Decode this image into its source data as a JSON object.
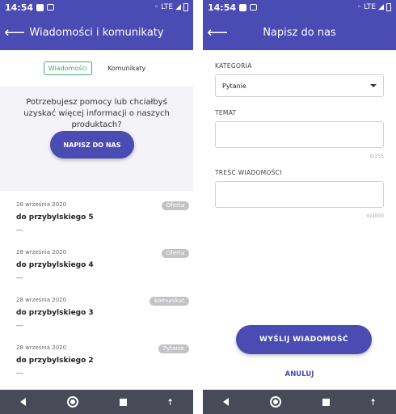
{
  "status": {
    "time": "14:54",
    "network": "LTE"
  },
  "left": {
    "title": "Wiadomości i komunikaty",
    "tabs": [
      {
        "label": "Wiadomości",
        "active": true
      },
      {
        "label": "Komunikaty",
        "active": false
      }
    ],
    "help_text": "Potrzebujesz pomocy lub chciałbyś uzyskać więcej informacji o naszych produktach?",
    "write_button": "NAPISZ DO NAS",
    "messages": [
      {
        "date": "28 września 2020",
        "badge": "Oferta",
        "title": "do przybylskiego 5",
        "preview": "---"
      },
      {
        "date": "28 września 2020",
        "badge": "Oferta",
        "title": "do przybylskiego 4",
        "preview": "---"
      },
      {
        "date": "28 września 2020",
        "badge": "Komunikat",
        "title": "do przybylskiego 3",
        "preview": "---"
      },
      {
        "date": "28 września 2020",
        "badge": "Pytanie",
        "title": "do przybylskiego 2",
        "preview": "---"
      }
    ]
  },
  "right": {
    "title": "Napisz do nas",
    "category_label": "KATEGORIA",
    "category_value": "Pytanie",
    "subject_label": "TEMAT",
    "subject_value": "",
    "subject_counter": "0/255",
    "message_label": "TREŚĆ WIADOMOŚCI",
    "message_value": "",
    "message_counter": "0/4000",
    "send_button": "WYŚLIJ WIADOMOŚĆ",
    "cancel_button": "ANULUJ"
  },
  "colors": {
    "primary": "#4a4bb3",
    "tab_active": "#3fae75",
    "badge": "#c2c2c8",
    "navbar": "#484b57"
  },
  "icons": [
    "back-arrow-icon",
    "dropdown-caret-icon",
    "nav-back-icon",
    "nav-home-icon",
    "nav-recents-icon",
    "accessibility-icon"
  ]
}
